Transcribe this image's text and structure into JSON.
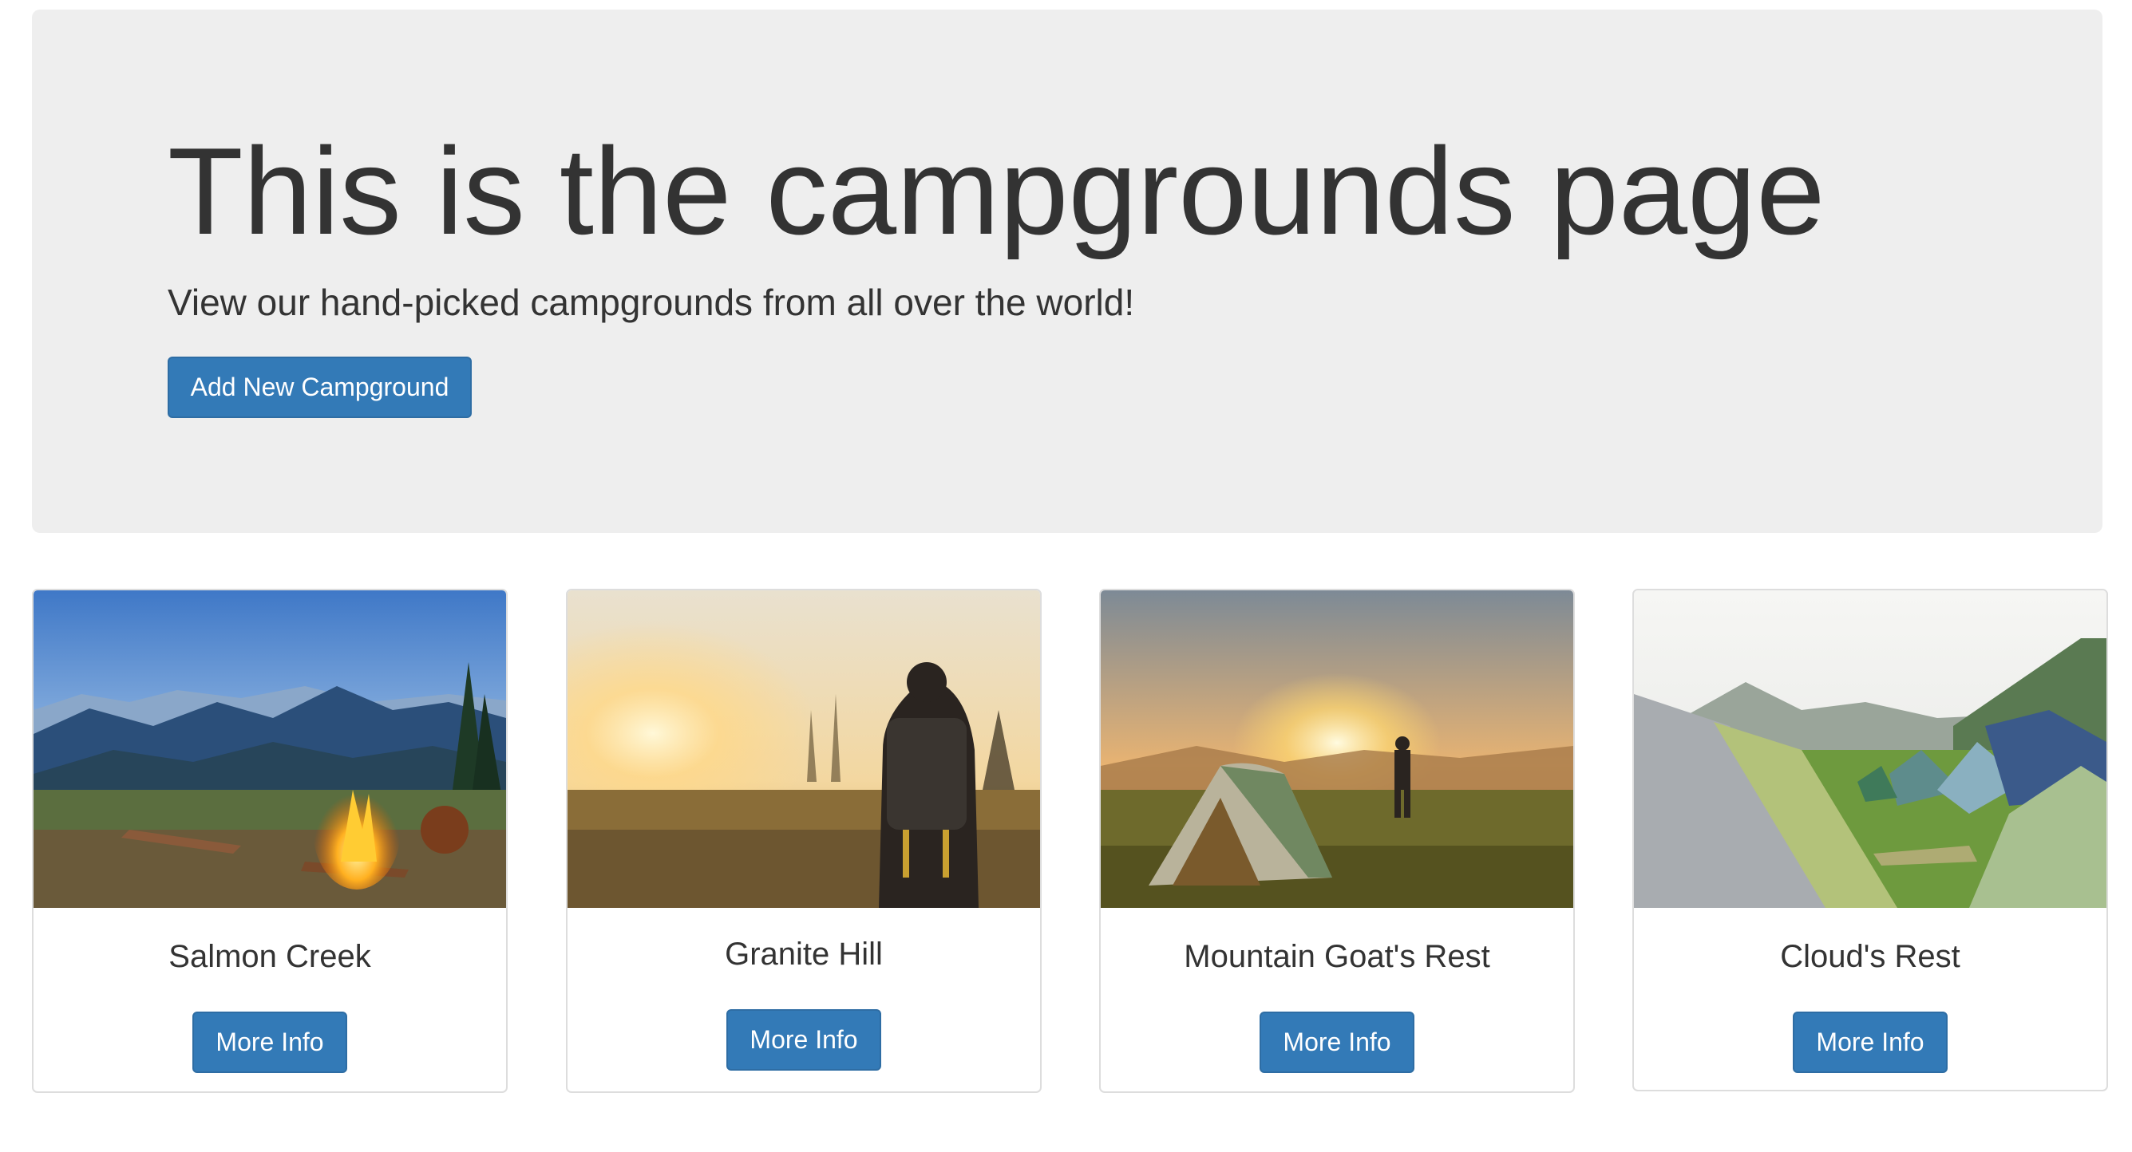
{
  "jumbotron": {
    "title": "This is the campgrounds page",
    "subtitle": "View our hand-picked campgrounds from all over the world!",
    "add_button_label": "Add New Campground"
  },
  "campgrounds": [
    {
      "name": "Salmon Creek",
      "button_label": "More Info"
    },
    {
      "name": "Granite Hill",
      "button_label": "More Info"
    },
    {
      "name": "Mountain Goat's Rest",
      "button_label": "More Info"
    },
    {
      "name": "Cloud's Rest",
      "button_label": "More Info"
    }
  ],
  "colors": {
    "primary": "#337ab7",
    "jumbotron_bg": "#eeeeee",
    "text": "#333333"
  }
}
